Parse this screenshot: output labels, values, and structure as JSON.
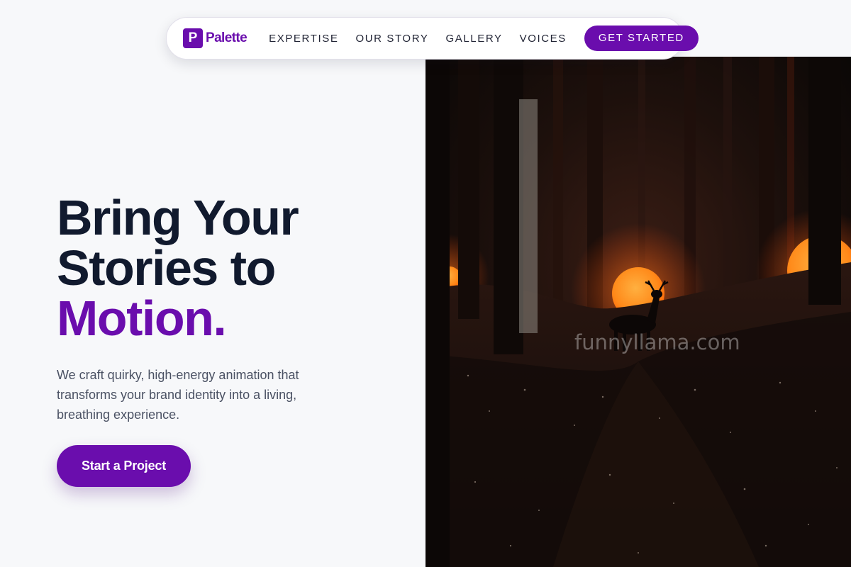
{
  "nav": {
    "brand_mark": "P",
    "brand_name": "Palette",
    "links": [
      {
        "label": "EXPERTISE"
      },
      {
        "label": "OUR STORY"
      },
      {
        "label": "GALLERY"
      },
      {
        "label": "VOICES"
      }
    ],
    "cta_label": "GET STARTED"
  },
  "hero": {
    "headline_line1": "Bring Your",
    "headline_line2": "Stories to",
    "headline_accent": "Motion",
    "headline_dot": ".",
    "lede": "We craft quirky, high-energy animation that transforms your brand identity into a living, breathing experience.",
    "cta_label": "Start a Project",
    "image_watermark": "funnyllama.com"
  },
  "colors": {
    "accent": "#6a0dad",
    "headline": "#111a2e",
    "body_text": "#4a5163",
    "page_background": "#f7f8fa",
    "glow_orange": "#ff8a1a"
  }
}
